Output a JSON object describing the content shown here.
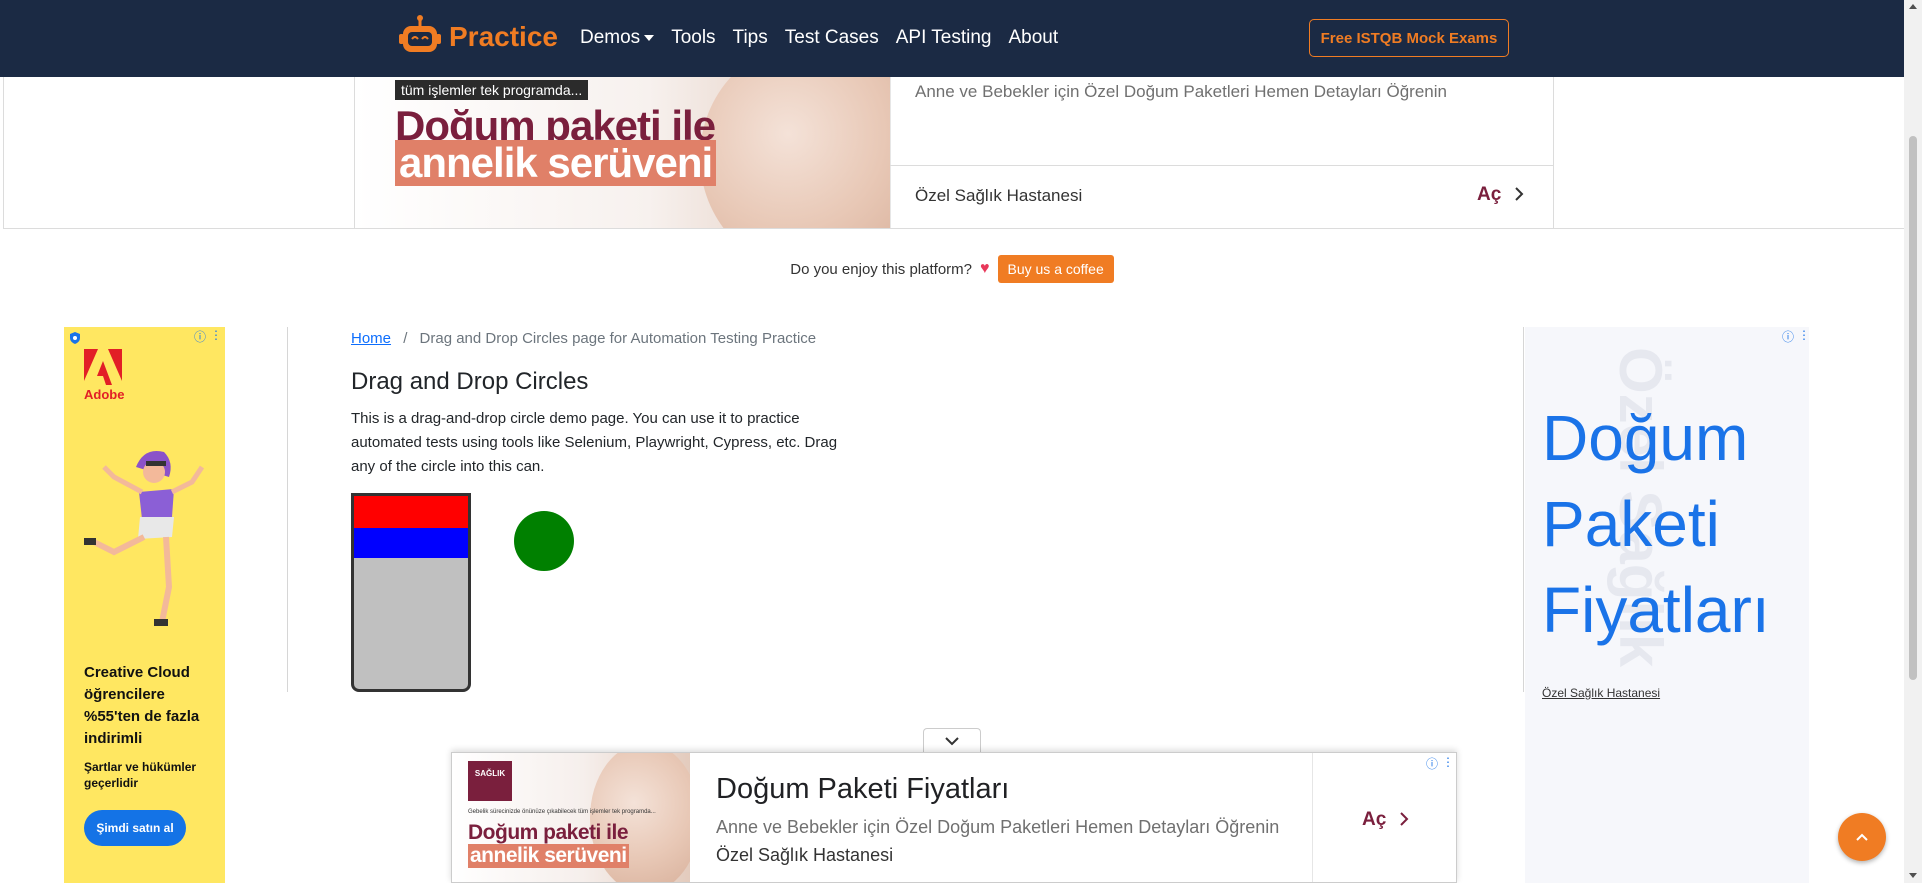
{
  "navbar": {
    "brand": "Practice",
    "links": [
      "Demos",
      "Tools",
      "Tips",
      "Test Cases",
      "API Testing",
      "About"
    ],
    "cta": "Free ISTQB Mock Exams"
  },
  "top_ad": {
    "tag": "tüm işlemler tek programda...",
    "headline_1": "Doğum paketi ile",
    "headline_2": "annelik serüveni",
    "description": "Anne ve Bebekler için Özel Doğum Paketleri Hemen Detayları Öğrenin",
    "sponsor": "Özel Sağlık Hastanesi",
    "open_label": "Aç"
  },
  "coffee": {
    "text": "Do you enjoy this platform?",
    "heart": "♥",
    "button": "Buy us a coffee"
  },
  "left_ad": {
    "brand": "Adobe",
    "title": "Creative Cloud öğrencilere %55'ten de fazla indirimli",
    "subtitle": "Şartlar ve hükümler geçerlidir",
    "button": "Şimdi satın al",
    "brand_color": "#e21f26",
    "background_color": "#ffe761"
  },
  "breadcrumb": {
    "home": "Home",
    "separator": "/",
    "current": "Drag and Drop Circles page for Automation Testing Practice"
  },
  "main": {
    "title": "Drag and Drop Circles",
    "description": "This is a drag-and-drop circle demo page. You can use it to practice automated tests using tools like Selenium, Playwright, Cypress, etc. Drag any of the circle into this can.",
    "can_items": [
      "red",
      "blue"
    ],
    "free_circles": [
      "green"
    ],
    "colors": {
      "red": "#ff0000",
      "blue": "#0000ff",
      "green": "#008000",
      "can": "#c0c0c0"
    }
  },
  "right_ad": {
    "title": "Doğum Paketi Fiyatları",
    "background_text": "Özel Sağlık",
    "sponsor": "Özel Sağlık Hastanesi",
    "accent_color": "#1a73e8"
  },
  "bottom_ad": {
    "badge": "SAĞLIK",
    "tag": "Gebelik sürecinizde önünüze çıkabilecek tüm işlemler tek programda...",
    "headline_1": "Doğum paketi ile",
    "headline_2": "annelik serüveni",
    "title": "Doğum Paketi Fiyatları",
    "description": "Anne ve Bebekler için Özel Doğum Paketleri Hemen Detayları Öğrenin",
    "sponsor": "Özel Sağlık Hastanesi",
    "open_label": "Aç"
  },
  "theme": {
    "navbar_bg": "#1b2a44",
    "accent": "#f07c23",
    "ad_brand": "#7a1f3d"
  }
}
